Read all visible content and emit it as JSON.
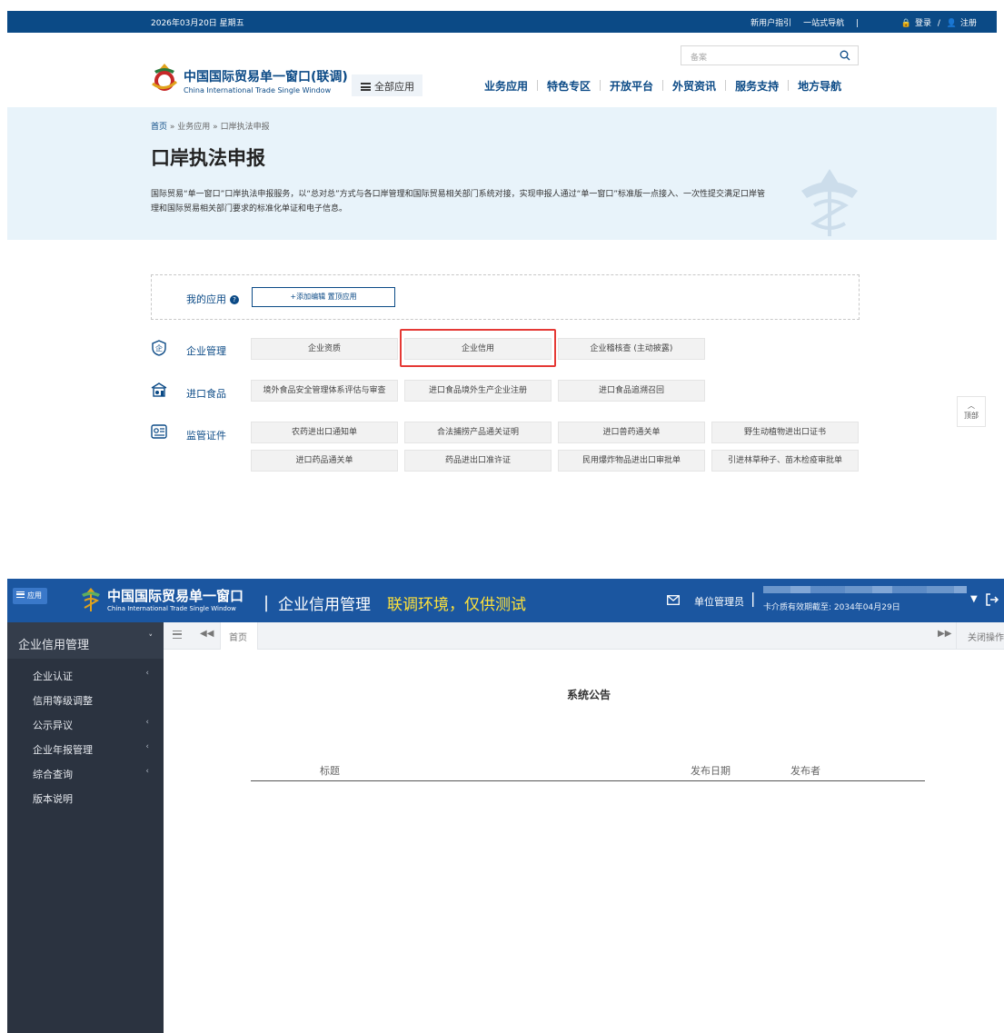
{
  "portal": {
    "topbar": {
      "date": "2026年03月20日 星期五",
      "guide": "新用户指引",
      "one_stop": "一站式导航",
      "login": "登录",
      "slash": "/",
      "register": "注册"
    },
    "search": {
      "placeholder": "备案"
    },
    "logo": {
      "title": "中国国际贸易单一窗口(联调)",
      "subtitle": "China International Trade Single Window"
    },
    "all_apps": "全部应用",
    "nav": [
      "业务应用",
      "特色专区",
      "开放平台",
      "外贸资讯",
      "服务支持",
      "地方导航"
    ],
    "breadcrumb": {
      "home": "首页",
      "sep": "»",
      "level1": "业务应用",
      "level2": "口岸执法申报"
    },
    "title": "口岸执法申报",
    "description": "国际贸易“单一窗口”口岸执法申报服务，以“总对总”方式与各口岸管理和国际贸易相关部门系统对接，实现申报人通过“单一窗口”标准版一点接入、一次性提交满足口岸管理和国际贸易相关部门要求的标准化单证和电子信息。",
    "my_apps": {
      "label": "我的应用",
      "add_button": "+添加编辑 置顶应用"
    },
    "categories": [
      {
        "name": "企业管理",
        "icon": "enterprise-icon",
        "services": [
          "企业资质",
          "企业信用",
          "企业稽核查 (主动披露)"
        ]
      },
      {
        "name": "进口食品",
        "icon": "food-icon",
        "services": [
          "境外食品安全管理体系评估与审查",
          "进口食品境外生产企业注册",
          "进口食品追溯召回"
        ]
      },
      {
        "name": "监管证件",
        "icon": "certificate-icon",
        "services": [
          "农药进出口通知单",
          "合法捕捞产品通关证明",
          "进口兽药通关单",
          "野生动植物进出口证书",
          "进口药品通关单",
          "药品进出口准许证",
          "民用爆炸物品进出口审批单",
          "引进林草种子、苗木检疫审批单"
        ]
      }
    ],
    "to_top": "顶部",
    "highlight_color": "#e53935"
  },
  "credit_system": {
    "menu_button": "应用",
    "logo": {
      "title": "中国国际贸易单一窗口",
      "subtitle": "China International Trade Single Window"
    },
    "divider": "|",
    "app_name": "企业信用管理",
    "environment_notice": "联调环境，仅供测试",
    "user": {
      "role": "单位管理员",
      "separator": "|",
      "card_expiry": "卡介质有效期截至: 2034年04月29日"
    },
    "sidebar": {
      "header": "企业信用管理",
      "items": [
        {
          "label": "企业认证",
          "expandable": true
        },
        {
          "label": "信用等级调整",
          "expandable": false
        },
        {
          "label": "公示异议",
          "expandable": true
        },
        {
          "label": "企业年报管理",
          "expandable": true
        },
        {
          "label": "综合查询",
          "expandable": true
        },
        {
          "label": "版本说明",
          "expandable": false
        }
      ]
    },
    "tabs": {
      "home": "首页",
      "close_ops": "关闭操作"
    },
    "notice": {
      "title": "系统公告",
      "columns": [
        "标题",
        "发布日期",
        "发布者"
      ]
    },
    "colors": {
      "header": "#1b56a0",
      "sidebar": "#2b3340",
      "environment": "#ffe23a"
    }
  }
}
